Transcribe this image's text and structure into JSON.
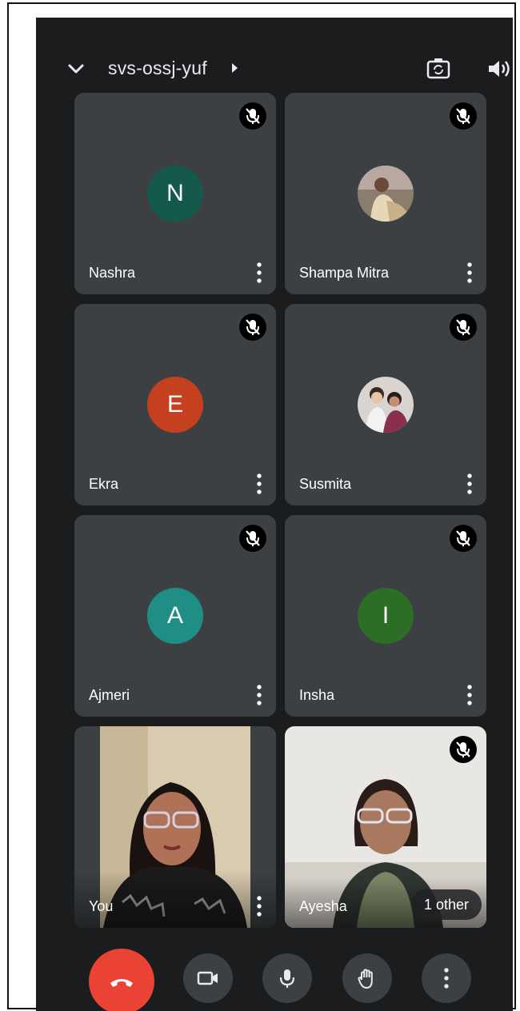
{
  "meeting": {
    "code": "svs-ossj-yuf"
  },
  "participants": [
    {
      "name": "Nashra",
      "initial": "N",
      "avatar_color": "#15594d",
      "muted": true
    },
    {
      "name": "Shampa Mitra",
      "initial": "",
      "muted": true
    },
    {
      "name": "Ekra",
      "initial": "E",
      "avatar_color": "#c5401f",
      "muted": true
    },
    {
      "name": "Susmita",
      "initial": "",
      "muted": true
    },
    {
      "name": "Ajmeri",
      "initial": "A",
      "avatar_color": "#1f8f85",
      "muted": true
    },
    {
      "name": "Insha",
      "initial": "I",
      "avatar_color": "#2c6e26",
      "muted": true
    },
    {
      "name": "You",
      "initial": "",
      "muted": false
    },
    {
      "name": "Ayesha",
      "initial": "",
      "muted": true
    }
  ],
  "overflow": {
    "label": "1 other"
  },
  "colors": {
    "background": "#1b1c1e",
    "tile": "#3c4043",
    "hangup": "#ea4335"
  },
  "controls": [
    "end-call",
    "camera",
    "microphone",
    "raise-hand",
    "more-options"
  ]
}
